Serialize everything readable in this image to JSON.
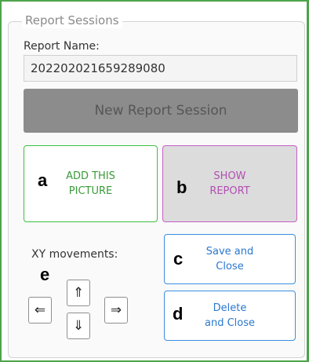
{
  "panel": {
    "legend": "Report Sessions",
    "report_name_label": "Report Name:",
    "report_name_value": "202202021659289080",
    "new_session_label": "New Report Session"
  },
  "tiles": {
    "add_picture": {
      "letter": "a",
      "line1": "ADD THIS",
      "line2": "PICTURE"
    },
    "show_report": {
      "letter": "b",
      "line1": "SHOW",
      "line2": "REPORT"
    },
    "save_close": {
      "letter": "c",
      "line1": "Save and",
      "line2": "Close"
    },
    "delete_close": {
      "letter": "d",
      "line1": "Delete",
      "line2": "and Close"
    }
  },
  "movements": {
    "label": "XY movements:",
    "letter": "e",
    "up": "⇑",
    "left": "⇐",
    "right": "⇒",
    "down": "⇓"
  },
  "colors": {
    "frame_border": "#4ea44a",
    "add_picture": "#3fbf3f",
    "show_report": "#c55fc5",
    "save_delete": "#3b8fe0",
    "new_session_bg": "#8c8c8c"
  }
}
